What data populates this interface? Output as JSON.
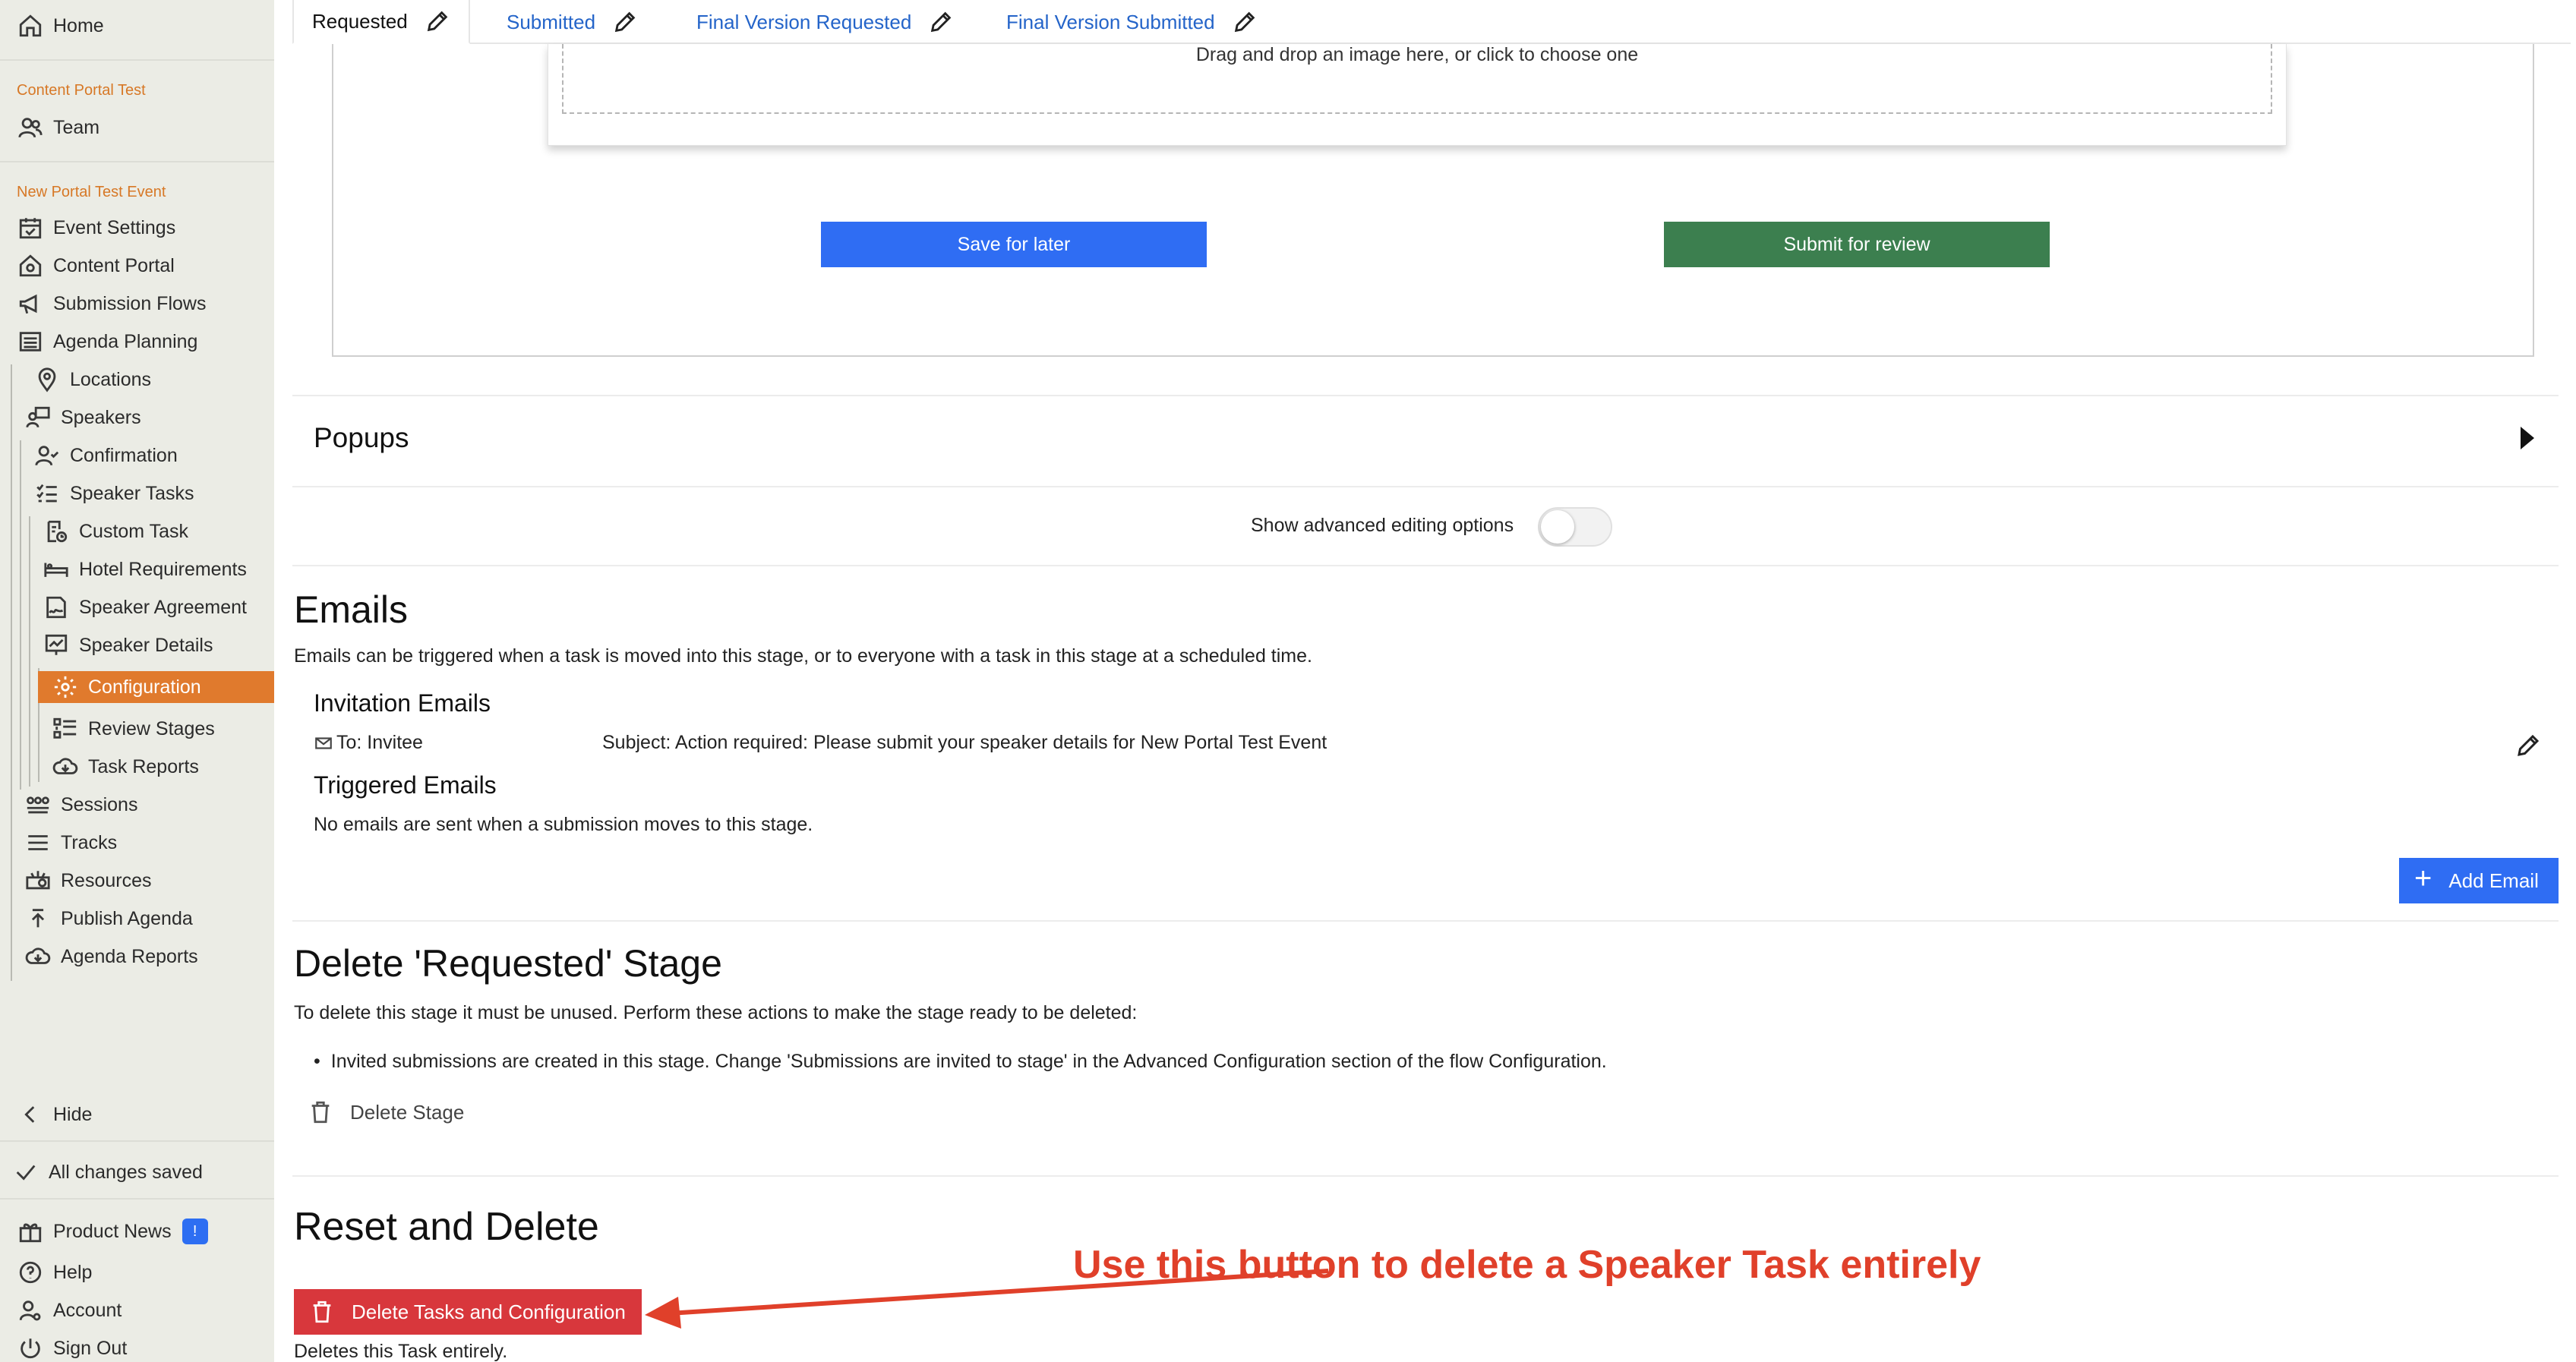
{
  "sidebar": {
    "home": "Home",
    "section1": "Content Portal Test",
    "team": "Team",
    "section2": "New Portal Test Event",
    "items": [
      {
        "label": "Event Settings",
        "icon": "calendar-check-icon"
      },
      {
        "label": "Content Portal",
        "icon": "home-gear-icon"
      },
      {
        "label": "Submission Flows",
        "icon": "megaphone-icon"
      },
      {
        "label": "Agenda Planning",
        "icon": "list-icon"
      },
      {
        "label": "Locations",
        "icon": "map-pin-icon"
      },
      {
        "label": "Speakers",
        "icon": "speaker-icon"
      },
      {
        "label": "Confirmation",
        "icon": "user-check-icon"
      },
      {
        "label": "Speaker Tasks",
        "icon": "checklist-icon"
      },
      {
        "label": "Custom Task",
        "icon": "doc-clock-icon"
      },
      {
        "label": "Hotel Requirements",
        "icon": "bed-icon"
      },
      {
        "label": "Speaker Agreement",
        "icon": "signature-icon"
      },
      {
        "label": "Speaker Details",
        "icon": "presentation-icon"
      },
      {
        "label": "Configuration",
        "icon": "gear-icon"
      },
      {
        "label": "Review Stages",
        "icon": "stages-icon"
      },
      {
        "label": "Task Reports",
        "icon": "cloud-download-icon"
      },
      {
        "label": "Sessions",
        "icon": "people-icon"
      },
      {
        "label": "Tracks",
        "icon": "lines-icon"
      },
      {
        "label": "Resources",
        "icon": "projector-icon"
      },
      {
        "label": "Publish Agenda",
        "icon": "upload-icon"
      },
      {
        "label": "Agenda Reports",
        "icon": "cloud-download-icon"
      }
    ],
    "hide": "Hide",
    "saved": "All changes saved",
    "product_news": "Product News",
    "product_news_badge": "!",
    "help": "Help",
    "account": "Account",
    "sign_out": "Sign Out",
    "accent_color": "#e07a2d"
  },
  "tabs": [
    {
      "label": "Requested",
      "active": true
    },
    {
      "label": "Submitted"
    },
    {
      "label": "Final Version Requested"
    },
    {
      "label": "Final Version Submitted"
    }
  ],
  "dropzone": {
    "text": "Drag and drop an image here, or click to choose one"
  },
  "buttons": {
    "save_later": "Save for later",
    "submit_review": "Submit for review"
  },
  "popups": {
    "title": "Popups"
  },
  "advanced": {
    "label": "Show advanced editing options",
    "enabled": false
  },
  "emails": {
    "title": "Emails",
    "description": "Emails can be triggered when a task is moved into this stage, or to everyone with a task in this stage at a scheduled time.",
    "invitation_title": "Invitation Emails",
    "to": "To: Invitee",
    "subject": "Subject: Action required: Please submit your speaker details for New Portal Test Event",
    "triggered_title": "Triggered Emails",
    "triggered_none": "No emails are sent when a submission moves to this stage.",
    "add_email": "Add Email"
  },
  "delete_stage": {
    "title": "Delete 'Requested' Stage",
    "description": "To delete this stage it must be unused. Perform these actions to make the stage ready to be deleted:",
    "bullet": "Invited submissions are created in this stage. Change 'Submissions are invited to stage' in the Advanced Configuration section of the flow Configuration.",
    "button": "Delete Stage"
  },
  "reset": {
    "title": "Reset and Delete",
    "button": "Delete Tasks and Configuration",
    "note": "Deletes this Task entirely.",
    "annotation": "Use this button to delete a Speaker Task entirely",
    "annotation_color": "#e0402a"
  }
}
